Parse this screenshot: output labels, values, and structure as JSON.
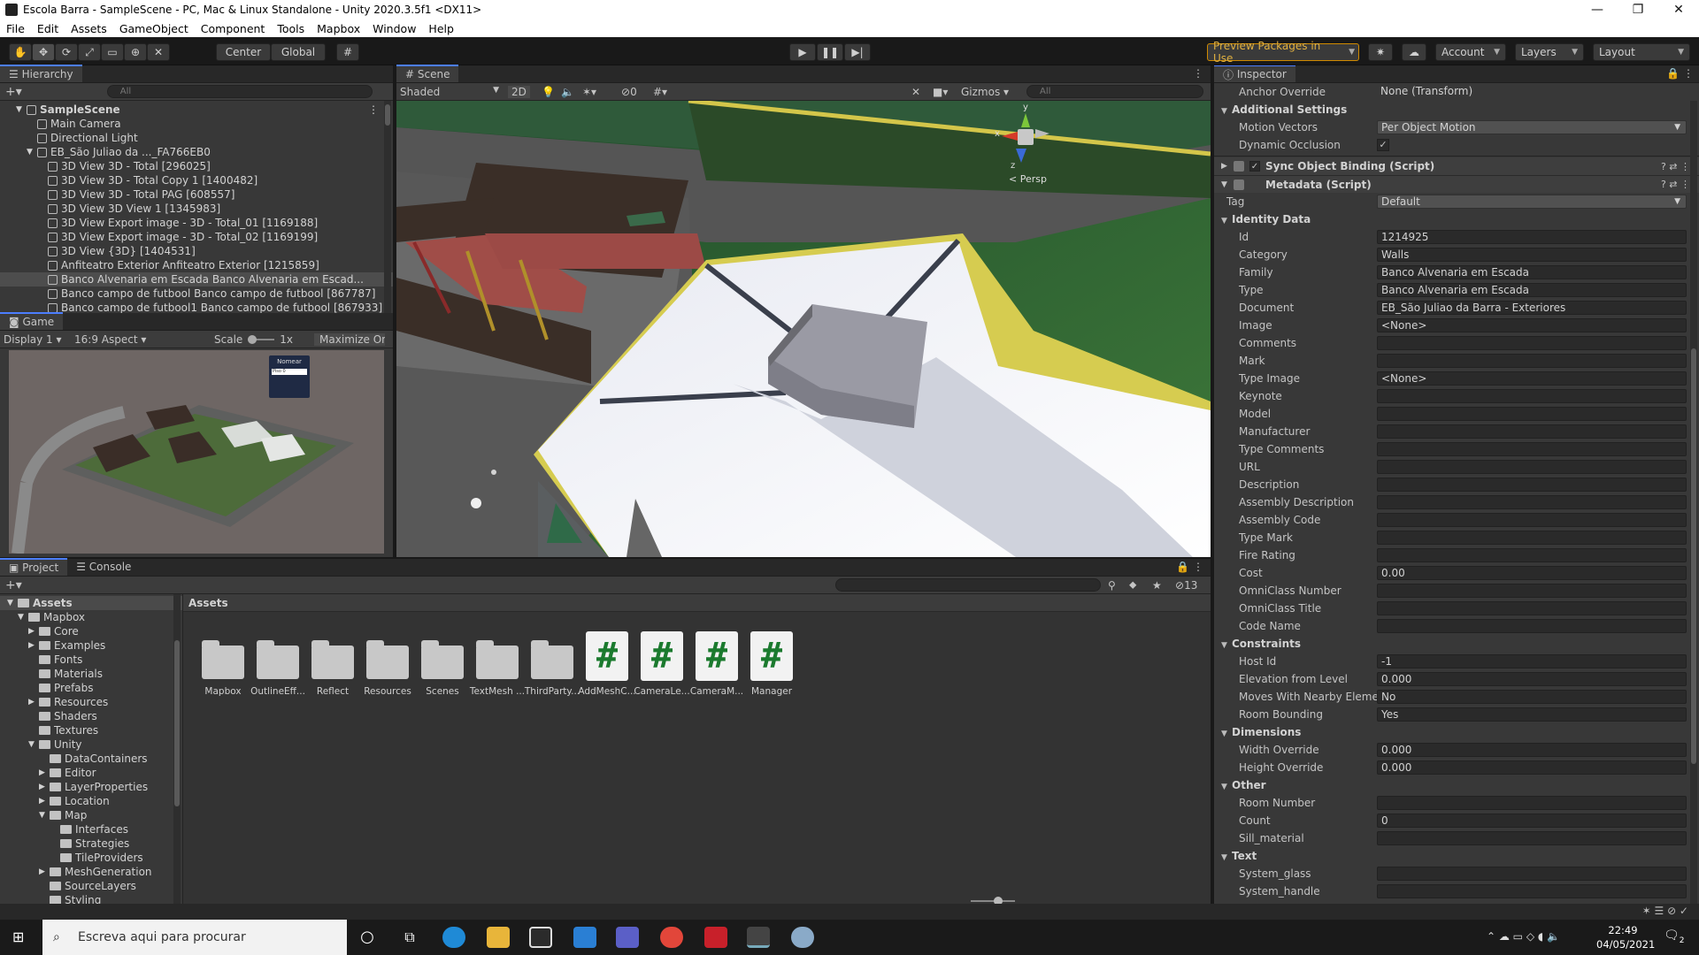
{
  "window": {
    "title": "Escola Barra - SampleScene - PC, Mac & Linux Standalone - Unity 2020.3.5f1 <DX11>"
  },
  "menu": [
    "File",
    "Edit",
    "Assets",
    "GameObject",
    "Component",
    "Tools",
    "Mapbox",
    "Window",
    "Help"
  ],
  "toolbar": {
    "center_label": "Center",
    "global_label": "Global",
    "preview_label": "Preview Packages in Use",
    "account_label": "Account",
    "layers_label": "Layers",
    "layout_label": "Layout"
  },
  "hierarchy": {
    "tab": "Hierarchy",
    "search_placeholder": "All",
    "items": [
      {
        "label": "SampleScene",
        "indent": 0,
        "kind": "scene"
      },
      {
        "label": "Main Camera",
        "indent": 1,
        "kind": "obj"
      },
      {
        "label": "Directional Light",
        "indent": 1,
        "kind": "obj"
      },
      {
        "label": "EB_São Juliao da ..._FA766EB0",
        "indent": 1,
        "kind": "obj"
      },
      {
        "label": "3D View 3D - Total [296025]",
        "indent": 2,
        "kind": "obj"
      },
      {
        "label": "3D View 3D - Total Copy 1 [1400482]",
        "indent": 2,
        "kind": "obj"
      },
      {
        "label": "3D View 3D - Total PAG [608557]",
        "indent": 2,
        "kind": "obj"
      },
      {
        "label": "3D View 3D View 1 [1345983]",
        "indent": 2,
        "kind": "obj"
      },
      {
        "label": "3D View Export image - 3D - Total_01 [1169188]",
        "indent": 2,
        "kind": "obj"
      },
      {
        "label": "3D View Export image - 3D - Total_02 [1169199]",
        "indent": 2,
        "kind": "obj"
      },
      {
        "label": "3D View {3D} [1404531]",
        "indent": 2,
        "kind": "obj"
      },
      {
        "label": "Anfiteatro Exterior Anfiteatro Exterior [1215859]",
        "indent": 2,
        "kind": "obj"
      },
      {
        "label": "Banco Alvenaria em Escada Banco Alvenaria em Escad...",
        "indent": 2,
        "kind": "obj",
        "selected": true
      },
      {
        "label": "Banco campo de futbool Banco campo de futbool [867787]",
        "indent": 2,
        "kind": "obj"
      },
      {
        "label": "Banco campo de futbool1 Banco campo de futbool [867933]",
        "indent": 2,
        "kind": "obj"
      }
    ]
  },
  "game": {
    "tab": "Game",
    "display": "Display 1",
    "aspect": "16:9 Aspect",
    "scale_label": "Scale",
    "scale_value": "1x",
    "maximize": "Maximize On P",
    "overlay_title": "Nomear",
    "overlay_field": "Piso 0"
  },
  "scene": {
    "tab": "Scene",
    "shading": "Shaded",
    "mode_2d": "2D",
    "hidden_count": "0",
    "gizmos": "Gizmos",
    "search_placeholder": "All",
    "persp": "< Persp",
    "axis_x": "x",
    "axis_y": "y",
    "axis_z": "z"
  },
  "inspector": {
    "tab": "Inspector",
    "anchor_label": "Anchor Override",
    "anchor_value": "None (Transform)",
    "additional": "Additional Settings",
    "motion_label": "Motion Vectors",
    "motion_value": "Per Object Motion",
    "occlusion_label": "Dynamic Occlusion",
    "occlusion_check": "✓",
    "comp1": "Sync Object Binding (Script)",
    "comp2": "Metadata (Script)",
    "tag_label": "Tag",
    "tag_value": "Default",
    "groups": [
      {
        "title": "Identity Data",
        "rows": [
          [
            "Id",
            "1214925"
          ],
          [
            "Category",
            "Walls"
          ],
          [
            "Family",
            "Banco Alvenaria em Escada"
          ],
          [
            "Type",
            "Banco Alvenaria em Escada"
          ],
          [
            "Document",
            "EB_São Juliao da Barra - Exteriores"
          ],
          [
            "Image",
            "<None>"
          ],
          [
            "Comments",
            ""
          ],
          [
            "Mark",
            ""
          ],
          [
            "Type Image",
            "<None>"
          ],
          [
            "Keynote",
            ""
          ],
          [
            "Model",
            ""
          ],
          [
            "Manufacturer",
            ""
          ],
          [
            "Type Comments",
            ""
          ],
          [
            "URL",
            ""
          ],
          [
            "Description",
            ""
          ],
          [
            "Assembly Description",
            ""
          ],
          [
            "Assembly Code",
            ""
          ],
          [
            "Type Mark",
            ""
          ],
          [
            "Fire Rating",
            ""
          ],
          [
            "Cost",
            "0.00"
          ],
          [
            "OmniClass Number",
            ""
          ],
          [
            "OmniClass Title",
            ""
          ],
          [
            "Code Name",
            ""
          ]
        ]
      },
      {
        "title": "Constraints",
        "rows": [
          [
            "Host Id",
            "-1"
          ],
          [
            "Elevation from Level",
            "0.000"
          ],
          [
            "Moves With Nearby Elements",
            "No"
          ],
          [
            "Room Bounding",
            "Yes"
          ]
        ]
      },
      {
        "title": "Dimensions",
        "rows": [
          [
            "Width Override",
            "0.000"
          ],
          [
            "Height Override",
            "0.000"
          ]
        ]
      },
      {
        "title": "Other",
        "rows": [
          [
            "Room Number",
            ""
          ],
          [
            "Count",
            "0"
          ],
          [
            "Sill_material",
            ""
          ]
        ]
      },
      {
        "title": "Text",
        "rows": [
          [
            "System_glass",
            ""
          ],
          [
            "System_handle",
            ""
          ]
        ]
      }
    ]
  },
  "project": {
    "tab1": "Project",
    "tab2": "Console",
    "header": "Assets",
    "hidden_count": "13",
    "tree": [
      {
        "label": "Assets",
        "indent": 0,
        "open": true,
        "bold": true
      },
      {
        "label": "Mapbox",
        "indent": 1,
        "open": true
      },
      {
        "label": "Core",
        "indent": 2,
        "arrow": true
      },
      {
        "label": "Examples",
        "indent": 2,
        "arrow": true
      },
      {
        "label": "Fonts",
        "indent": 2
      },
      {
        "label": "Materials",
        "indent": 2
      },
      {
        "label": "Prefabs",
        "indent": 2
      },
      {
        "label": "Resources",
        "indent": 2,
        "arrow": true
      },
      {
        "label": "Shaders",
        "indent": 2
      },
      {
        "label": "Textures",
        "indent": 2
      },
      {
        "label": "Unity",
        "indent": 2,
        "open": true
      },
      {
        "label": "DataContainers",
        "indent": 3
      },
      {
        "label": "Editor",
        "indent": 3,
        "arrow": true
      },
      {
        "label": "LayerProperties",
        "indent": 3,
        "arrow": true
      },
      {
        "label": "Location",
        "indent": 3,
        "arrow": true
      },
      {
        "label": "Map",
        "indent": 3,
        "open": true
      },
      {
        "label": "Interfaces",
        "indent": 4
      },
      {
        "label": "Strategies",
        "indent": 4
      },
      {
        "label": "TileProviders",
        "indent": 4
      },
      {
        "label": "MeshGeneration",
        "indent": 3,
        "arrow": true
      },
      {
        "label": "SourceLayers",
        "indent": 3
      },
      {
        "label": "Styling",
        "indent": 3
      }
    ],
    "assets": [
      {
        "label": "Mapbox",
        "kind": "folder"
      },
      {
        "label": "OutlineEff...",
        "kind": "folder"
      },
      {
        "label": "Reflect",
        "kind": "folder"
      },
      {
        "label": "Resources",
        "kind": "folder"
      },
      {
        "label": "Scenes",
        "kind": "folder"
      },
      {
        "label": "TextMesh ...",
        "kind": "folder"
      },
      {
        "label": "ThirdParty...",
        "kind": "folder"
      },
      {
        "label": "AddMeshC...",
        "kind": "script"
      },
      {
        "label": "CameraLe...",
        "kind": "script"
      },
      {
        "label": "CameraM...",
        "kind": "script"
      },
      {
        "label": "Manager",
        "kind": "script"
      }
    ]
  },
  "taskbar": {
    "search_placeholder": "Escreva aqui para procurar",
    "time": "22:49",
    "date": "04/05/2021",
    "notif_count": "2"
  }
}
